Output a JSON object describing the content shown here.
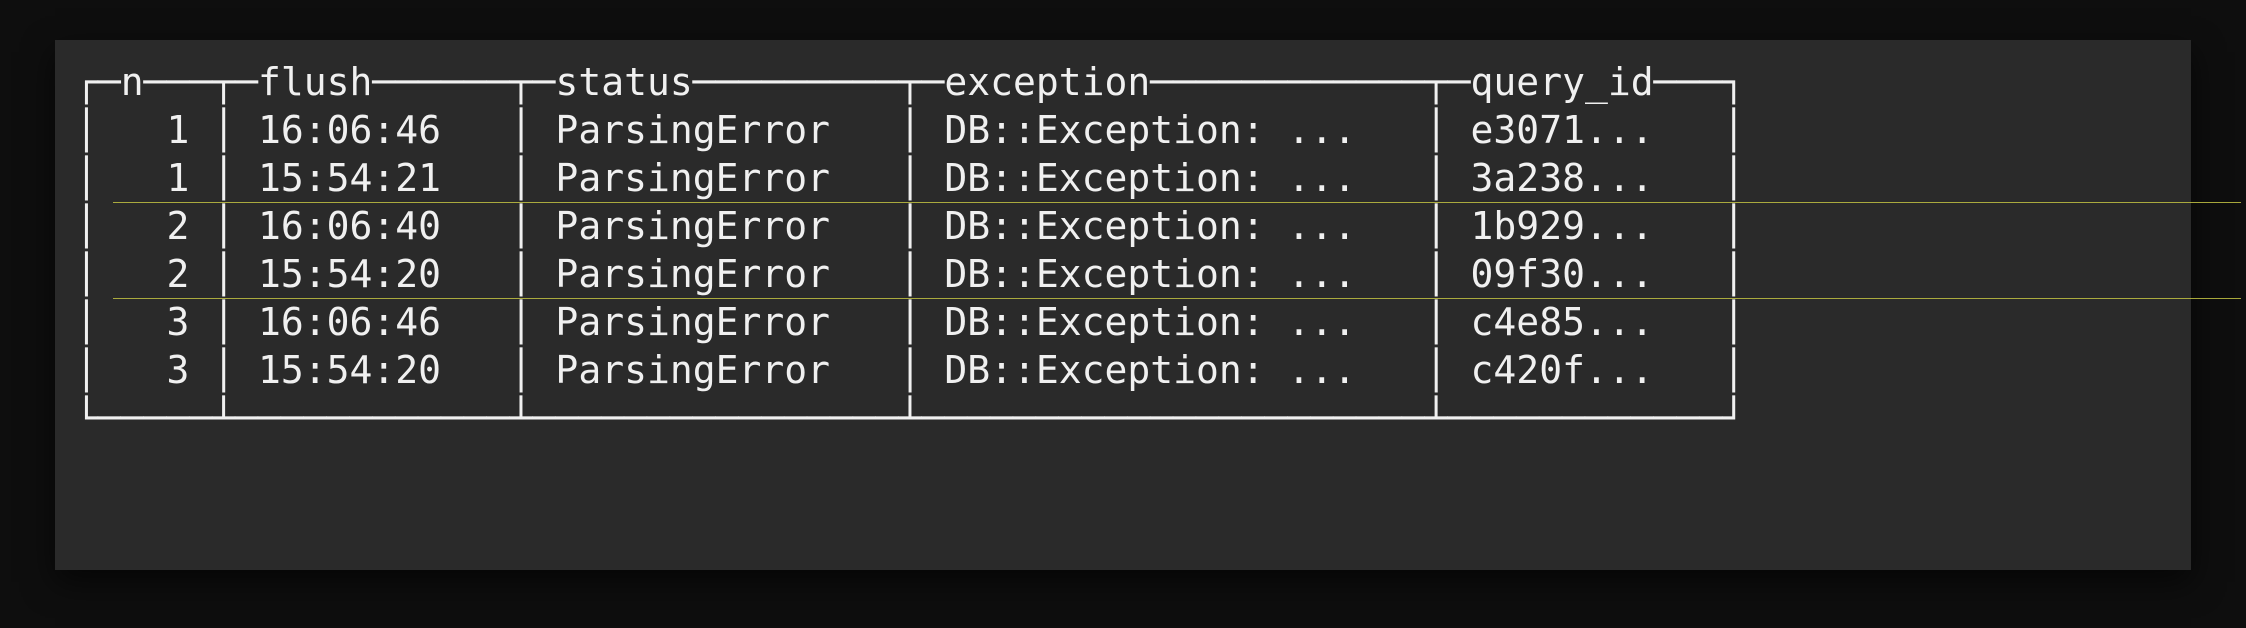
{
  "table": {
    "headers": {
      "n": "n",
      "flush": "flush",
      "status": "status",
      "exception": "exception",
      "query_id": "query_id"
    },
    "rows": [
      {
        "n": "1",
        "flush": "16:06:46",
        "status": "ParsingError",
        "exception": "DB::Exception: ...",
        "query_id": "e3071..."
      },
      {
        "n": "1",
        "flush": "15:54:21",
        "status": "ParsingError",
        "exception": "DB::Exception: ...",
        "query_id": "3a238..."
      },
      {
        "n": "2",
        "flush": "16:06:40",
        "status": "ParsingError",
        "exception": "DB::Exception: ...",
        "query_id": "1b929..."
      },
      {
        "n": "2",
        "flush": "15:54:20",
        "status": "ParsingError",
        "exception": "DB::Exception: ...",
        "query_id": "09f30..."
      },
      {
        "n": "3",
        "flush": "16:06:46",
        "status": "ParsingError",
        "exception": "DB::Exception: ...",
        "query_id": "c4e85..."
      },
      {
        "n": "3",
        "flush": "15:54:20",
        "status": "ParsingError",
        "exception": "DB::Exception: ...",
        "query_id": "c420f..."
      }
    ]
  },
  "box_chars": {
    "h": "─",
    "v": "│",
    "tl": "┌",
    "tr": "┐",
    "bl": "└",
    "br": "┘",
    "tt": "┬",
    "tb": "┴"
  },
  "col_widths": {
    "n": 3,
    "flush": 10,
    "status": 14,
    "exception": 20,
    "query_id": 10
  }
}
